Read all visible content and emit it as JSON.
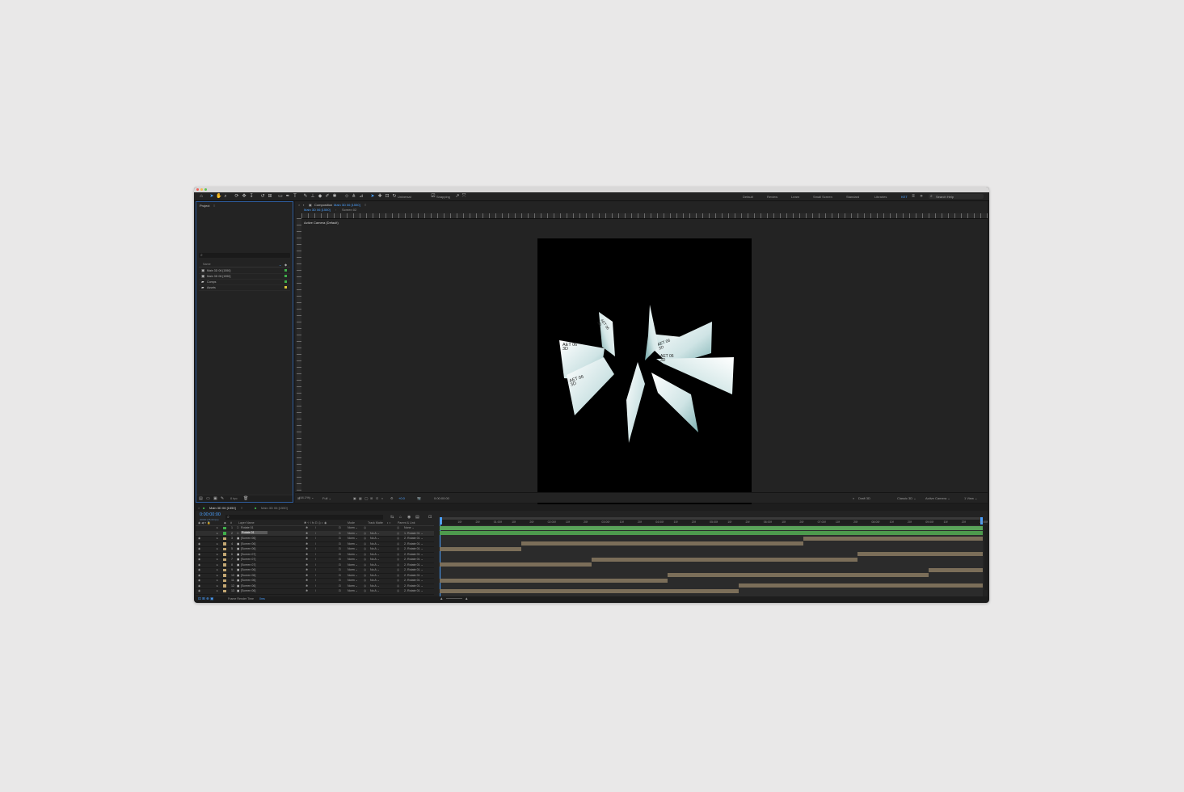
{
  "toolbar": {
    "workspaces": [
      "Default",
      "Review",
      "Learn",
      "Small Screen",
      "Standard",
      "Libraries",
      "KET"
    ],
    "search_placeholder": "Search Help",
    "universal_label": "Universal",
    "snapping_label": "Snapping"
  },
  "project": {
    "title": "Project",
    "column_name": "Name",
    "items": [
      {
        "name": "Main 3D 06 [1550]",
        "type": "comp",
        "label_color": "#3fae4a"
      },
      {
        "name": "Main 3D 06 [1550]",
        "type": "comp",
        "label_color": "#3fae4a"
      },
      {
        "name": "Comps",
        "type": "folder",
        "label_color": "#3fae4a"
      },
      {
        "name": "Assets",
        "type": "folder",
        "label_color": "#d8c43a"
      }
    ],
    "footer_bpc": "8 bpc"
  },
  "composition": {
    "panel_title": "Composition",
    "panel_comp_name": "Main 3D 06 [1550]",
    "tabs": [
      "Main 3D 06 [1550]",
      "Screen 02"
    ],
    "camera_label": "Active Camera (Default)",
    "card_text": "AET 06\n3D",
    "zoom": "(44.1%)",
    "resolution": "Full",
    "timecode": "0:00:00:00",
    "draft_label": "Draft 3D",
    "renderer": "Classic 3D",
    "camera_select": "Active Camera",
    "view_select": "1 View"
  },
  "timeline": {
    "tabs": [
      "Main 3D 06 [1550]",
      "Main 3D 06 [1550]"
    ],
    "current_time": "0:00:00:00",
    "frames_label": "00000 (25.00 fps)",
    "columns": {
      "layer_name": "Layer Name",
      "mode": "Mode",
      "trkmat": "Track Matte",
      "parent": "Parent & Link"
    },
    "layers": [
      {
        "num": "1",
        "name": "Rotate 01",
        "mode": "Norm",
        "trk": "",
        "parent": "None",
        "color": "#e6e6e6",
        "bar": [
          0,
          1.0
        ],
        "bar_color": "#5aa35a"
      },
      {
        "num": "2",
        "name": "Rotate 01",
        "mode": "Norm",
        "trk": "No A",
        "parent": "1. Rotate 01",
        "color": "#e6e6e6",
        "bar": [
          0,
          1.0
        ],
        "bar_color": "#4d9a4d"
      },
      {
        "num": "3",
        "name": "[Screen 06]",
        "mode": "Norm",
        "trk": "No A",
        "parent": "2. Rotate 01",
        "color": "#c2a672",
        "bar": [
          0.67,
          1.0
        ],
        "bar_color": "#7b6e59"
      },
      {
        "num": "4",
        "name": "[Screen 06]",
        "mode": "Norm",
        "trk": "No A",
        "parent": "2. Rotate 01",
        "color": "#c2a672",
        "bar": [
          0.15,
          0.67
        ],
        "bar_color": "#7b6e59"
      },
      {
        "num": "5",
        "name": "[Screen 06]",
        "mode": "Norm",
        "trk": "No A",
        "parent": "2. Rotate 01",
        "color": "#c2a672",
        "bar": [
          0,
          0.15
        ],
        "bar_color": "#7b6e59"
      },
      {
        "num": "6",
        "name": "[Screen 07]",
        "mode": "Norm",
        "trk": "No A",
        "parent": "2. Rotate 01",
        "color": "#c2a672",
        "bar": [
          0.77,
          1.0
        ],
        "bar_color": "#7b6e59"
      },
      {
        "num": "7",
        "name": "[Screen 07]",
        "mode": "Norm",
        "trk": "No A",
        "parent": "2. Rotate 01",
        "color": "#c2a672",
        "bar": [
          0.28,
          0.77
        ],
        "bar_color": "#7b6e59"
      },
      {
        "num": "8",
        "name": "[Screen 07]",
        "mode": "Norm",
        "trk": "No A",
        "parent": "2. Rotate 01",
        "color": "#c2a672",
        "bar": [
          0,
          0.28
        ],
        "bar_color": "#7b6e59"
      },
      {
        "num": "9",
        "name": "[Screen 06]",
        "mode": "Norm",
        "trk": "No A",
        "parent": "2. Rotate 01",
        "color": "#c2a672",
        "bar": [
          0.9,
          1.0
        ],
        "bar_color": "#7b6e59"
      },
      {
        "num": "10",
        "name": "[Screen 06]",
        "mode": "Norm",
        "trk": "No A",
        "parent": "2. Rotate 01",
        "color": "#c2a672",
        "bar": [
          0.42,
          0.9
        ],
        "bar_color": "#7b6e59"
      },
      {
        "num": "11",
        "name": "[Screen 06]",
        "mode": "Norm",
        "trk": "No A",
        "parent": "2. Rotate 01",
        "color": "#c2a672",
        "bar": [
          0,
          0.42
        ],
        "bar_color": "#7b6e59"
      },
      {
        "num": "12",
        "name": "[Screen 06]",
        "mode": "Norm",
        "trk": "No A",
        "parent": "2. Rotate 01",
        "color": "#c2a672",
        "bar": [
          0.55,
          1.0
        ],
        "bar_color": "#7b6e59"
      },
      {
        "num": "13",
        "name": "[Screen 06]",
        "mode": "Norm",
        "trk": "No A",
        "parent": "2. Rotate 01",
        "color": "#c2a672",
        "bar": [
          0,
          0.55
        ],
        "bar_color": "#7b6e59"
      }
    ],
    "ruler_ticks": [
      "0f",
      "10f",
      "20f",
      "01:00f",
      "10f",
      "20f",
      "02:00f",
      "10f",
      "20f",
      "03:00f",
      "10f",
      "20f",
      "04:00f",
      "10f",
      "20f",
      "05:00f",
      "10f",
      "20f",
      "06:00f",
      "10f",
      "20f",
      "07:00f",
      "10f",
      "20f",
      "08:00f",
      "10f",
      "20f",
      "09:00f",
      "10f",
      "20f",
      "10:00f"
    ],
    "footer_label": "Frame Render Time",
    "footer_value": "0ms"
  }
}
